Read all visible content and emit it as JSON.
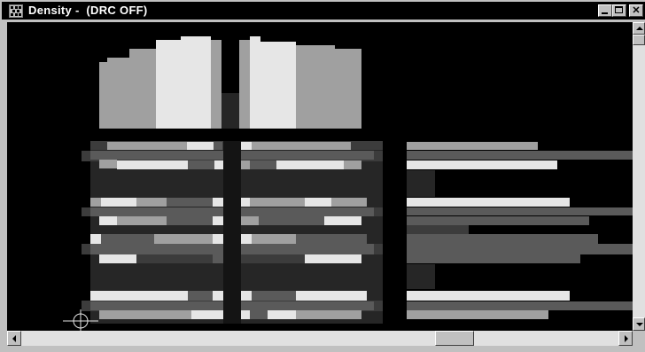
{
  "window": {
    "title": "Density -  (DRC OFF)",
    "icon": "layout-app-icon",
    "controls": [
      "minimize-icon",
      "maximize-icon",
      "close-icon"
    ]
  },
  "canvas": {
    "background": "#000000",
    "palette": {
      "light": "#e6e6e6",
      "mid": "#a0a0a0",
      "dark": "#5a5a5a",
      "darker": "#3c3c3c",
      "darkest": "#262626"
    }
  },
  "scrollbars": {
    "horizontal": {
      "position": 0.7
    },
    "vertical": {
      "position": 0.0
    }
  }
}
